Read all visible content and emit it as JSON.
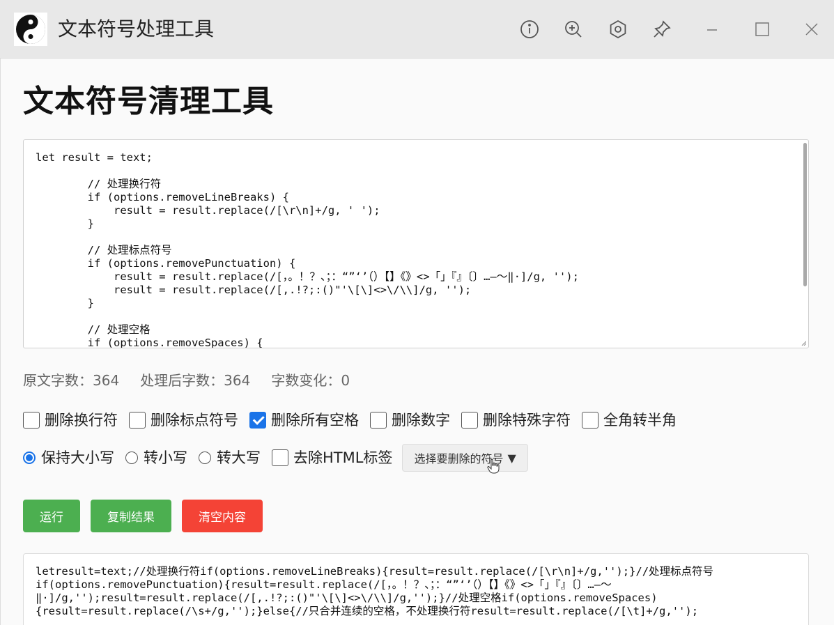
{
  "window": {
    "title": "文本符号处理工具",
    "icons": [
      "info-icon",
      "zoom-in-icon",
      "settings-icon",
      "pin-icon",
      "minimize-icon",
      "maximize-icon",
      "close-icon"
    ]
  },
  "page": {
    "title": "文本符号清理工具"
  },
  "editor": {
    "content": "let result = text;\n\n        // 处理换行符\n        if (options.removeLineBreaks) {\n            result = result.replace(/[\\r\\n]+/g, ' ');\n        }\n\n        // 处理标点符号\n        if (options.removePunctuation) {\n            result = result.replace(/[，。！？、；：“”‘’（）【】《》<>「」『』〔〕…—～‖·]/g, '');\n            result = result.replace(/[,.!?;:()\"'\\[\\]<>\\/\\\\]/g, '');\n        }\n\n        // 处理空格\n        if (options.removeSpaces) {"
  },
  "stats": {
    "original": "原文字数：364",
    "processed": "处理后字数：364",
    "change": "字数变化：0"
  },
  "options": {
    "row1": [
      {
        "label": "删除换行符",
        "checked": false
      },
      {
        "label": "删除标点符号",
        "checked": false
      },
      {
        "label": "删除所有空格",
        "checked": true
      },
      {
        "label": "删除数字",
        "checked": false
      },
      {
        "label": "删除特殊字符",
        "checked": false
      },
      {
        "label": "全角转半角",
        "checked": false
      }
    ],
    "case_radios": [
      {
        "label": "保持大小写",
        "checked": true
      },
      {
        "label": "转小写",
        "checked": false
      },
      {
        "label": "转大写",
        "checked": false
      }
    ],
    "strip_html": {
      "label": "去除HTML标签",
      "checked": false
    },
    "symbol_dropdown": {
      "label": "选择要删除的符号",
      "arrow": "▼"
    }
  },
  "actions": {
    "run": "运行",
    "copy": "复制结果",
    "clear": "清空内容"
  },
  "colors": {
    "green": "#4caf50",
    "red": "#f44336",
    "accent": "#1a73e8"
  },
  "output": {
    "content": "letresult=text;//处理换行符if(options.removeLineBreaks){result=result.replace(/[\\r\\n]+/g,'');}//处理标点符号\nif(options.removePunctuation){result=result.replace(/[，。！？、；：“”‘’（）【】《》<>「」『』〔〕…—～\n‖·]/g,'');result=result.replace(/[,.!?;:()\"'\\[\\]<>\\/\\\\]/g,'');}//处理空格if(options.removeSpaces)\n{result=result.replace(/\\s+/g,'');}else{//只合并连续的空格，不处理换行符result=result.replace(/[\\t]+/g,'');"
  }
}
